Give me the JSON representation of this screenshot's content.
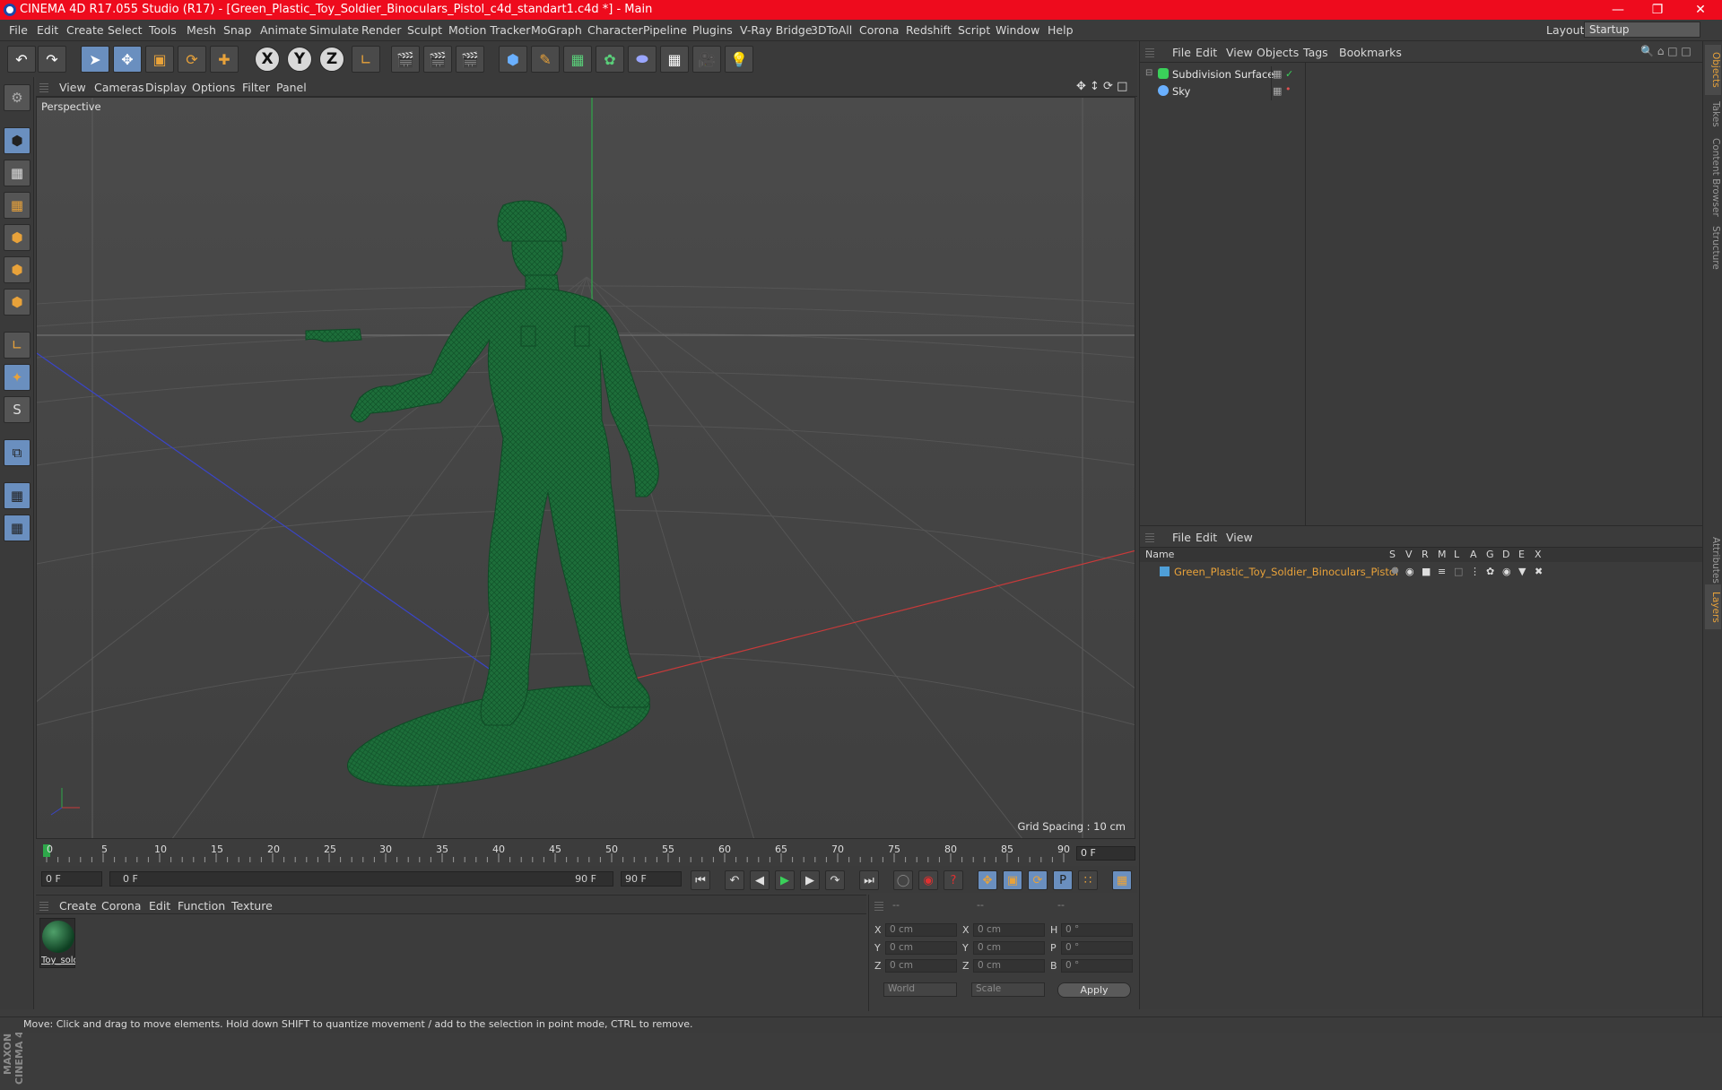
{
  "window": {
    "title": "CINEMA 4D R17.055 Studio (R17) - [Green_Plastic_Toy_Soldier_Binoculars_Pistol_c4d_standart1.c4d *] - Main",
    "minimize": "—",
    "restore": "❐",
    "close": "✕"
  },
  "menubar": {
    "items": [
      "File",
      "Edit",
      "Create",
      "Select",
      "Tools",
      "Mesh",
      "Snap",
      "Animate",
      "Simulate",
      "Render",
      "Sculpt",
      "Motion Tracker",
      "MoGraph",
      "Character",
      "Pipeline",
      "Plugins",
      "V-Ray Bridge",
      "3DToAll",
      "Corona",
      "Redshift",
      "Script",
      "Window",
      "Help"
    ],
    "layout_label": "Layout:",
    "layout_value": "Startup"
  },
  "toolbar": {
    "axis_x": "X",
    "axis_y": "Y",
    "axis_z": "Z"
  },
  "viewport": {
    "menu": [
      "View",
      "Cameras",
      "Display",
      "Options",
      "Filter",
      "Panel"
    ],
    "label": "Perspective",
    "grid_spacing": "Grid Spacing : 10 cm",
    "model_color": "#1d6e3a"
  },
  "timeline": {
    "ticks": [
      "0",
      "5",
      "10",
      "15",
      "20",
      "25",
      "30",
      "35",
      "40",
      "45",
      "50",
      "55",
      "60",
      "65",
      "70",
      "75",
      "80",
      "85",
      "90"
    ],
    "current_frame": "0 F",
    "start_field": "0 F",
    "range_start": "0 F",
    "range_end": "90 F",
    "end_field": "90 F"
  },
  "material_manager": {
    "menu": [
      "Create",
      "Corona",
      "Edit",
      "Function",
      "Texture"
    ],
    "material_name": "Toy_sold"
  },
  "coordinates": {
    "header": [
      "--",
      "--",
      "--"
    ],
    "rows": [
      {
        "a": "X",
        "av": "0 cm",
        "b": "X",
        "bv": "0 cm",
        "c": "H",
        "cv": "0 °"
      },
      {
        "a": "Y",
        "av": "0 cm",
        "b": "Y",
        "bv": "0 cm",
        "c": "P",
        "cv": "0 °"
      },
      {
        "a": "Z",
        "av": "0 cm",
        "b": "Z",
        "bv": "0 cm",
        "c": "B",
        "cv": "0 °"
      }
    ],
    "mode1": "World",
    "mode2": "Scale",
    "apply": "Apply"
  },
  "object_manager": {
    "menu": [
      "File",
      "Edit",
      "View",
      "Objects",
      "Tags",
      "Bookmarks"
    ],
    "objects": [
      {
        "name": "Subdivision Surface"
      },
      {
        "name": "Sky"
      }
    ]
  },
  "layer_manager": {
    "menu": [
      "File",
      "Edit",
      "View"
    ],
    "header_name": "Name",
    "columns": [
      "S",
      "V",
      "R",
      "M",
      "L",
      "A",
      "G",
      "D",
      "E",
      "X"
    ],
    "layer_name": "Green_Plastic_Toy_Soldier_Binoculars_Pistol"
  },
  "side_tabs": [
    "Objects",
    "Takes",
    "Content Browser",
    "Structure",
    "Attributes",
    "Layers"
  ],
  "maxon": "MAXON CINEMA 4D",
  "status": "Move: Click and drag to move elements. Hold down SHIFT to quantize movement / add to the selection in point mode, CTRL to remove."
}
